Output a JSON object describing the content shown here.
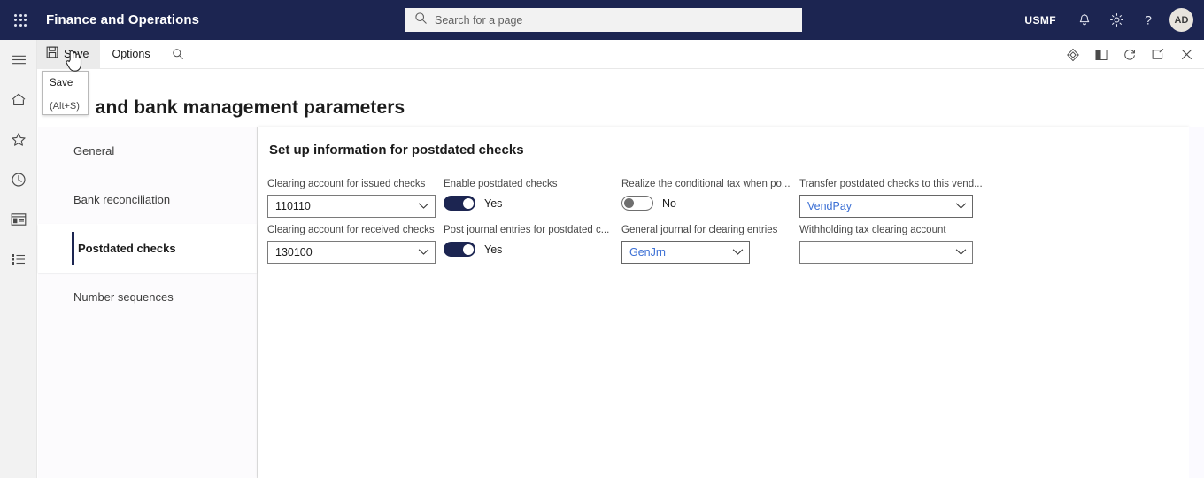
{
  "header": {
    "app_title": "Finance and Operations",
    "waffle_icon": "app-launcher-icon",
    "search_placeholder": "Search for a page",
    "search_icon": "search-icon",
    "company": "USMF",
    "notifications_icon": "bell-icon",
    "settings_icon": "gear-icon",
    "help_icon": "question-mark-icon",
    "avatar_initials": "AD"
  },
  "rail": {
    "items": [
      {
        "name": "hamburger-menu-icon"
      },
      {
        "name": "home-icon"
      },
      {
        "name": "favorites-star-icon"
      },
      {
        "name": "recent-clock-icon"
      },
      {
        "name": "workspaces-icon"
      },
      {
        "name": "modules-list-icon"
      }
    ]
  },
  "command_bar": {
    "save_label": "Save",
    "save_icon": "save-disk-icon",
    "options_label": "Options",
    "search_icon": "search-icon",
    "right_icons": [
      {
        "name": "attachments-gem-icon"
      },
      {
        "name": "split-pane-icon"
      },
      {
        "name": "refresh-icon"
      },
      {
        "name": "open-in-new-window-icon"
      },
      {
        "name": "close-icon"
      }
    ]
  },
  "tooltip": {
    "title": "Save",
    "shortcut": "(Alt+S)"
  },
  "page": {
    "title": "Cash and bank management parameters"
  },
  "tabs": [
    {
      "label": "General",
      "selected": false
    },
    {
      "label": "Bank reconciliation",
      "selected": false
    },
    {
      "label": "Postdated checks",
      "selected": true
    },
    {
      "label": "Number sequences",
      "selected": false
    }
  ],
  "form": {
    "section_title": "Set up information for postdated checks",
    "fields": [
      {
        "label": "Clearing account for issued checks",
        "type": "combo",
        "value": "110110",
        "link": false,
        "chevron_icon": "chevron-down-icon"
      },
      {
        "label": "Clearing account for received checks",
        "type": "combo",
        "value": "130100",
        "link": false,
        "chevron_icon": "chevron-down-icon"
      },
      {
        "label": "Enable postdated checks",
        "type": "toggle",
        "state": "on",
        "state_label": "Yes"
      },
      {
        "label": "Post journal entries for postdated c...",
        "type": "toggle",
        "state": "on",
        "state_label": "Yes"
      },
      {
        "label": "Realize the conditional tax when po...",
        "type": "toggle",
        "state": "off",
        "state_label": "No"
      },
      {
        "label": "General journal for clearing entries",
        "type": "combo",
        "value": "GenJrn",
        "link": true,
        "chevron_icon": "chevron-down-icon"
      },
      {
        "label": "Transfer postdated checks to this vend...",
        "type": "combo",
        "value": "VendPay",
        "link": true,
        "chevron_icon": "chevron-down-icon"
      },
      {
        "label": "Withholding tax clearing account",
        "type": "combo",
        "value": "",
        "link": false,
        "chevron_icon": "chevron-down-icon"
      }
    ]
  },
  "colors": {
    "header_bg": "#1c2551",
    "accent": "#1c2551",
    "link": "#3b6fd4",
    "rail_bg": "#f2f2f2"
  }
}
